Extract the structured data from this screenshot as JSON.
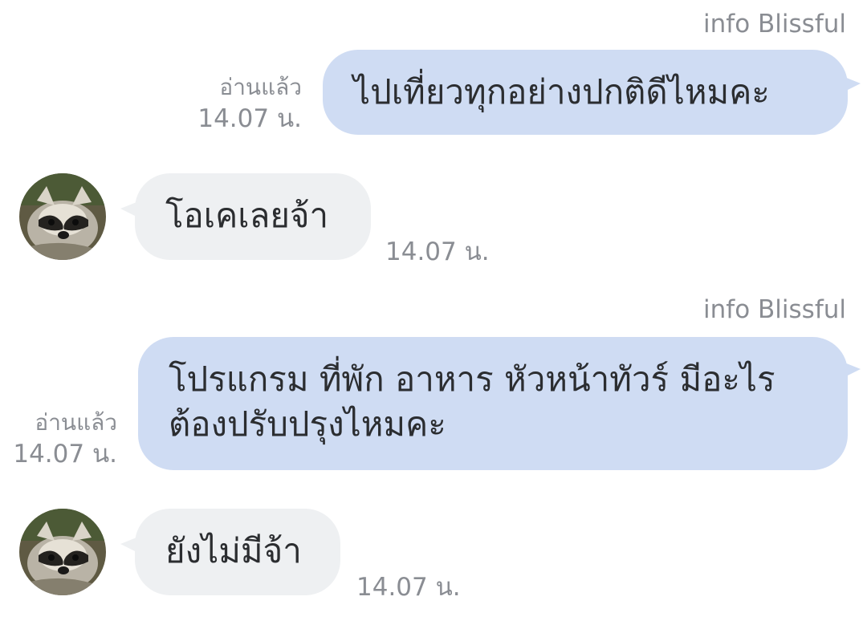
{
  "messages": [
    {
      "direction": "outgoing",
      "sender": "info Blissful",
      "text": "ไปเที่ยวทุกอย่างปกติดีไหมคะ",
      "read_label": "อ่านแล้ว",
      "time": "14.07 น."
    },
    {
      "direction": "incoming",
      "avatar": "raccoon-avatar",
      "text": "โอเคเลยจ้า",
      "time": "14.07 น."
    },
    {
      "direction": "outgoing",
      "sender": "info Blissful",
      "text_line1": "โปรแกรม ที่พัก อาหาร หัวหน้าทัวร์ มีอะไร",
      "text_line2": "ต้องปรับปรุงไหมคะ",
      "read_label": "อ่านแล้ว",
      "time": "14.07 น."
    },
    {
      "direction": "incoming",
      "avatar": "raccoon-avatar",
      "text": "ยังไม่มีจ้า",
      "time": "14.07 น."
    }
  ],
  "colors": {
    "outgoing_bubble": "#cfdcf3",
    "incoming_bubble": "#eef0f2",
    "meta_text": "#8a8d93",
    "message_text": "#2b2d30"
  }
}
